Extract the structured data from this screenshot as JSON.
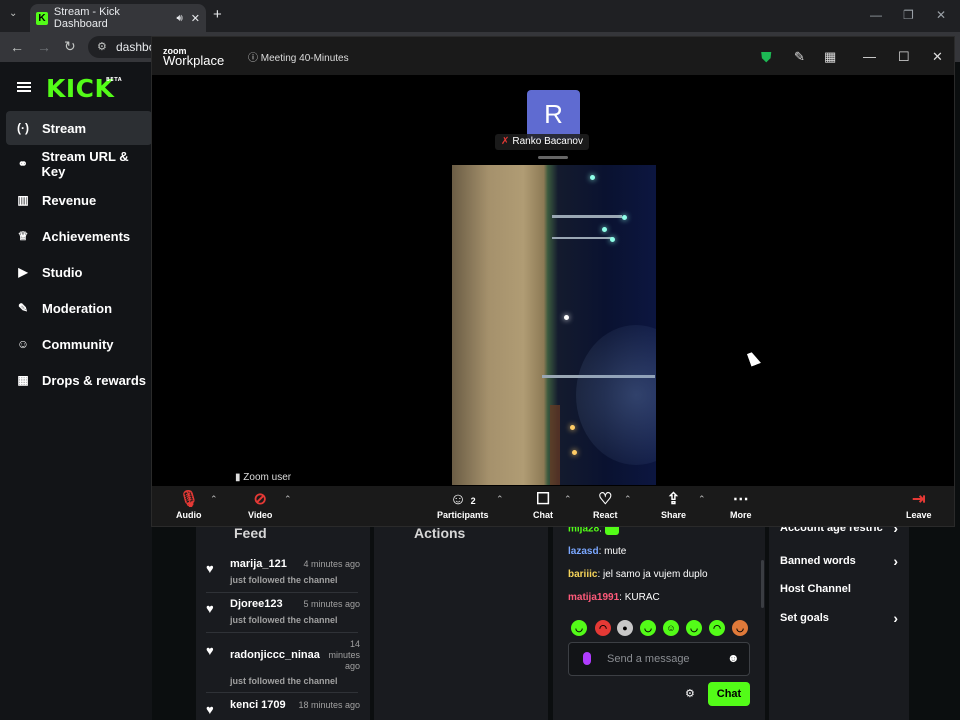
{
  "browser": {
    "tab_title": "Stream - Kick Dashboard",
    "tab_favicon": "K",
    "new_tab": "+",
    "url_text": "dashbo"
  },
  "kick": {
    "logo": "KICK",
    "logo_badge": "BETA",
    "nav": [
      {
        "label": "Stream",
        "icon": "broadcast-icon",
        "glyph": "(·)",
        "active": true
      },
      {
        "label": "Stream URL & Key",
        "icon": "link-icon",
        "glyph": "⚭"
      },
      {
        "label": "Revenue",
        "icon": "bar-chart-icon",
        "glyph": "▥"
      },
      {
        "label": "Achievements",
        "icon": "trophy-icon",
        "glyph": "♕"
      },
      {
        "label": "Studio",
        "icon": "video-icon",
        "glyph": "▶"
      },
      {
        "label": "Moderation",
        "icon": "wrench-icon",
        "glyph": "✎"
      },
      {
        "label": "Community",
        "icon": "people-icon",
        "glyph": "☺"
      },
      {
        "label": "Drops & rewards",
        "icon": "gift-icon",
        "glyph": "▦"
      }
    ]
  },
  "zoom": {
    "brand_line1": "zoom",
    "brand_line2": "Workplace",
    "meeting_title": "Meeting 40-Minutes",
    "participant_initial": "R",
    "participant_name": "Ranko Bacanov",
    "video_user_label": "Zoom user",
    "toolbar": {
      "audio": "Audio",
      "video": "Video",
      "participants": "Participants",
      "participants_count": "2",
      "chat": "Chat",
      "react": "React",
      "share": "Share",
      "more": "More",
      "leave": "Leave"
    },
    "colors": {
      "security": "#1db954",
      "leave": "#e53935",
      "avatar": "#5f6bd1"
    }
  },
  "dashboard": {
    "feed_title": "Feed",
    "actions_title": "Actions",
    "feed": [
      {
        "user": "marija_121",
        "time": "4 minutes ago",
        "action": "just followed the channel"
      },
      {
        "user": "Djoree123",
        "time": "5 minutes ago",
        "action": "just followed the channel"
      },
      {
        "user": "radonjiccc_ninaa",
        "time_l1": "14",
        "time_l2": "minutes",
        "time_l3": "ago",
        "action": "just followed the channel"
      },
      {
        "user": "kenci 1709",
        "time": "18 minutes ago"
      }
    ],
    "chat": [
      {
        "user": "mija28",
        "text": "",
        "color": "#53fc18"
      },
      {
        "user": "lazasd",
        "text": ": mute",
        "color": "#7aa7ff"
      },
      {
        "user": "bariiic",
        "text": ": jel samo ja vujem duplo",
        "color": "#f5d35a"
      },
      {
        "user": "matija1991",
        "text": ": KURAC",
        "color": "#ff5a7a"
      }
    ],
    "chat_placeholder": "Send a message",
    "chat_button": "Chat",
    "controls": [
      {
        "label": "Account age restric",
        "chevron": true
      },
      {
        "label": "Banned words",
        "chevron": true
      },
      {
        "label": "Host Channel",
        "chevron": false
      },
      {
        "label": "Set goals",
        "chevron": true
      }
    ],
    "accent": "#53fc18"
  }
}
